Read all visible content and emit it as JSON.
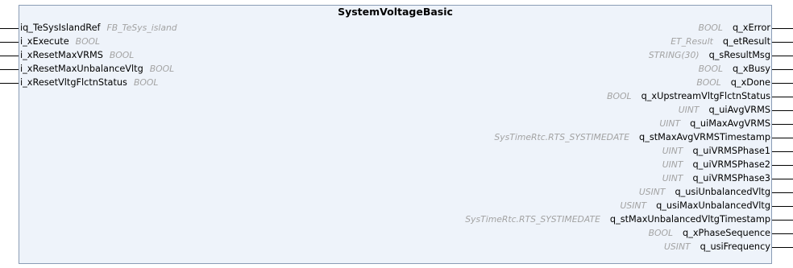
{
  "block": {
    "title": "SystemVoltageBasic"
  },
  "inputs": [
    {
      "name": "iq_TeSysIslandRef",
      "type": "FB_TeSys_island"
    },
    {
      "name": "i_xExecute",
      "type": "BOOL"
    },
    {
      "name": "i_xResetMaxVRMS",
      "type": "BOOL"
    },
    {
      "name": "i_xResetMaxUnbalanceVltg",
      "type": "BOOL"
    },
    {
      "name": "i_xResetVltgFlctnStatus",
      "type": "BOOL"
    }
  ],
  "outputs": [
    {
      "type": "BOOL",
      "name": "q_xError"
    },
    {
      "type": "ET_Result",
      "name": "q_etResult"
    },
    {
      "type": "STRING(30)",
      "name": "q_sResultMsg"
    },
    {
      "type": "BOOL",
      "name": "q_xBusy"
    },
    {
      "type": "BOOL",
      "name": "q_xDone"
    },
    {
      "type": "BOOL",
      "name": "q_xUpstreamVltgFlctnStatus"
    },
    {
      "type": "UINT",
      "name": "q_uiAvgVRMS"
    },
    {
      "type": "UINT",
      "name": "q_uiMaxAvgVRMS"
    },
    {
      "type": "SysTimeRtc.RTS_SYSTIMEDATE",
      "name": "q_stMaxAvgVRMSTimestamp"
    },
    {
      "type": "UINT",
      "name": "q_uiVRMSPhase1"
    },
    {
      "type": "UINT",
      "name": "q_uiVRMSPhase2"
    },
    {
      "type": "UINT",
      "name": "q_uiVRMSPhase3"
    },
    {
      "type": "USINT",
      "name": "q_usiUnbalancedVltg"
    },
    {
      "type": "USINT",
      "name": "q_usiMaxUnbalancedVltg"
    },
    {
      "type": "SysTimeRtc.RTS_SYSTIMEDATE",
      "name": "q_stMaxUnbalancedVltgTimestamp"
    },
    {
      "type": "BOOL",
      "name": "q_xPhaseSequence"
    },
    {
      "type": "USINT",
      "name": "q_usiFrequency"
    }
  ],
  "colors": {
    "block_fill": "#eef3fa",
    "block_border": "#8a9cb5",
    "type_text": "#a3a3a3"
  }
}
